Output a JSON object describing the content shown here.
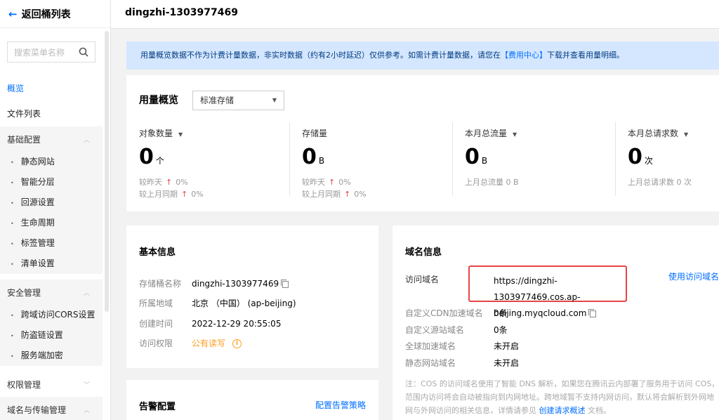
{
  "sidebar": {
    "back_label": "返回桶列表",
    "search_placeholder": "搜索菜单名称",
    "items": {
      "overview": "概览",
      "files": "文件列表"
    },
    "group_basic": "基础配置",
    "basic_subs": [
      "静态网站",
      "智能分层",
      "回源设置",
      "生命周期",
      "标签管理",
      "清单设置"
    ],
    "group_security": "安全管理",
    "security_subs": [
      "跨域访问CORS设置",
      "防盗链设置",
      "服务端加密"
    ],
    "group_permission": "权限管理",
    "group_domain": "域名与传输管理"
  },
  "header": {
    "title": "dingzhi-1303977469"
  },
  "notice": {
    "text_before": "用量概览数据不作为计费计量数据，非实时数据（约有2小时延迟）仅供参考。如需计费计量数据，请您在",
    "link": "【费用中心】",
    "text_after": "下载并查看用量明细。"
  },
  "usage": {
    "title": "用量概览",
    "storage_class": "标准存储",
    "metrics": [
      {
        "label": "对象数量",
        "value": "0",
        "unit": "个",
        "line1_label": "较昨天",
        "line1_value": "0%",
        "line2_label": "较上月同期",
        "line2_value": "0%"
      },
      {
        "label": "存储量",
        "value": "0",
        "unit": "B",
        "line1_label": "较昨天",
        "line1_value": "0%",
        "line2_label": "较上月同期",
        "line2_value": "0%"
      },
      {
        "label": "本月总流量",
        "value": "0",
        "unit": "B",
        "line1_text": "上月总流量 0 B"
      },
      {
        "label": "本月总请求数",
        "value": "0",
        "unit": "次",
        "line1_text": "上月总请求数 0 次"
      }
    ]
  },
  "basic": {
    "title": "基本信息",
    "rows": [
      {
        "key": "存储桶名称",
        "value": "dingzhi-1303977469"
      },
      {
        "key": "所属地域",
        "value": "北京 （中国） (ap-beijing)"
      },
      {
        "key": "创建时间",
        "value": "2022-12-29 20:55:05"
      },
      {
        "key": "访问权限",
        "value": "公有读写"
      }
    ]
  },
  "alert": {
    "title": "告警配置",
    "link": "配置告警策略"
  },
  "domain": {
    "title": "域名信息",
    "access_label": "访问域名",
    "access_url_line1": "https://dingzhi-1303977469.cos.ap-",
    "access_url_line2": "beijing.myqcloud.com",
    "use_link": "使用访问域名访",
    "rows": [
      {
        "key": "自定义CDN加速域名",
        "value": "0条"
      },
      {
        "key": "自定义源站域名",
        "value": "0条"
      },
      {
        "key": "全球加速域名",
        "value": "未开启"
      },
      {
        "key": "静态网站域名",
        "value": "未开启"
      }
    ],
    "note_line1": "注：COS 的访问域名使用了智能 DNS 解析，如果您在腾讯云内部署了服务用于访问 COS，",
    "note_line2": "范围内访问将会自动被指向到内网地址。跨地域暂不支持内网访问，默认将会解析到外网地",
    "note_line3_before": "网与外网访问的相关信息，详情请参见",
    "note_link": "创建请求概述",
    "note_line3_after": "文档。"
  }
}
